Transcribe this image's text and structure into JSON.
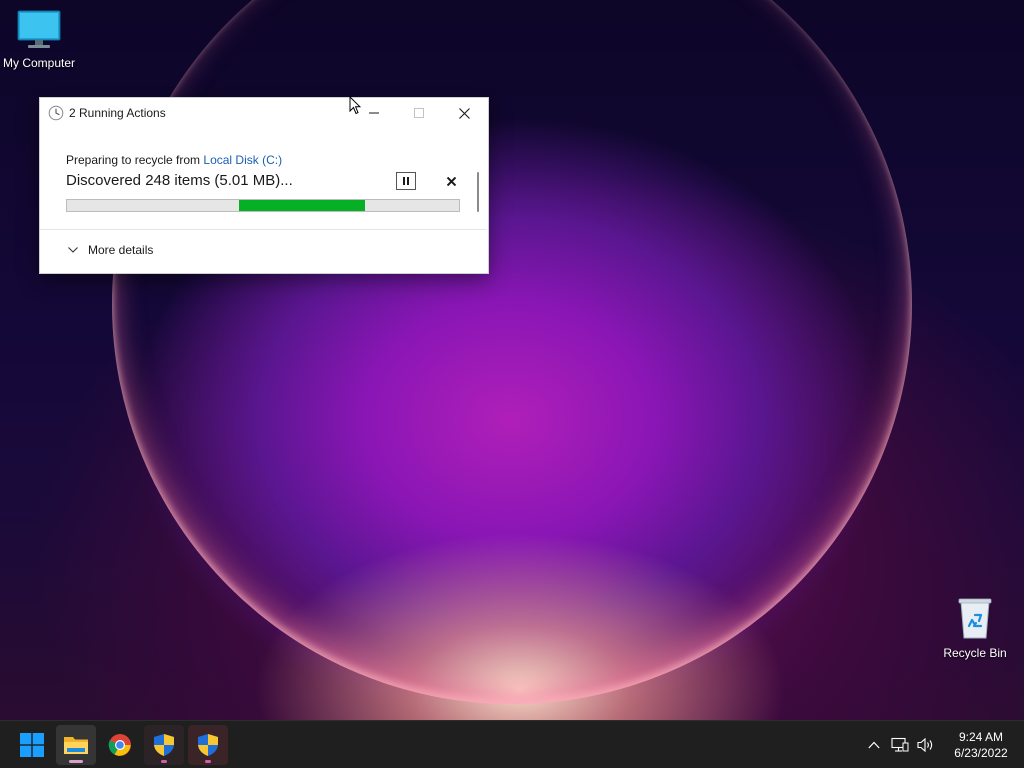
{
  "desktop": {
    "icons": [
      {
        "label": "My Computer",
        "icon": "monitor-icon"
      },
      {
        "label": "Recycle Bin",
        "icon": "recycle-bin-icon"
      }
    ]
  },
  "dialog": {
    "title": "2 Running Actions",
    "subtitle_prefix": "Preparing to recycle from ",
    "subtitle_link": "Local Disk (C:)",
    "status": "Discovered 248 items (5.01 MB)...",
    "more_details": "More details",
    "progress": {
      "start_fraction": 0.44,
      "end_fraction": 0.76,
      "color": "#06b025"
    }
  },
  "taskbar": {
    "items": [
      "start-button",
      "file-explorer",
      "chrome",
      "uac-shield",
      "uac-shield"
    ],
    "time": "9:24 AM",
    "date": "6/23/2022"
  },
  "colors": {
    "link": "#1a5fb4",
    "taskbar_bg": "#1f1f1f",
    "accent_blue": "#0078d4"
  }
}
